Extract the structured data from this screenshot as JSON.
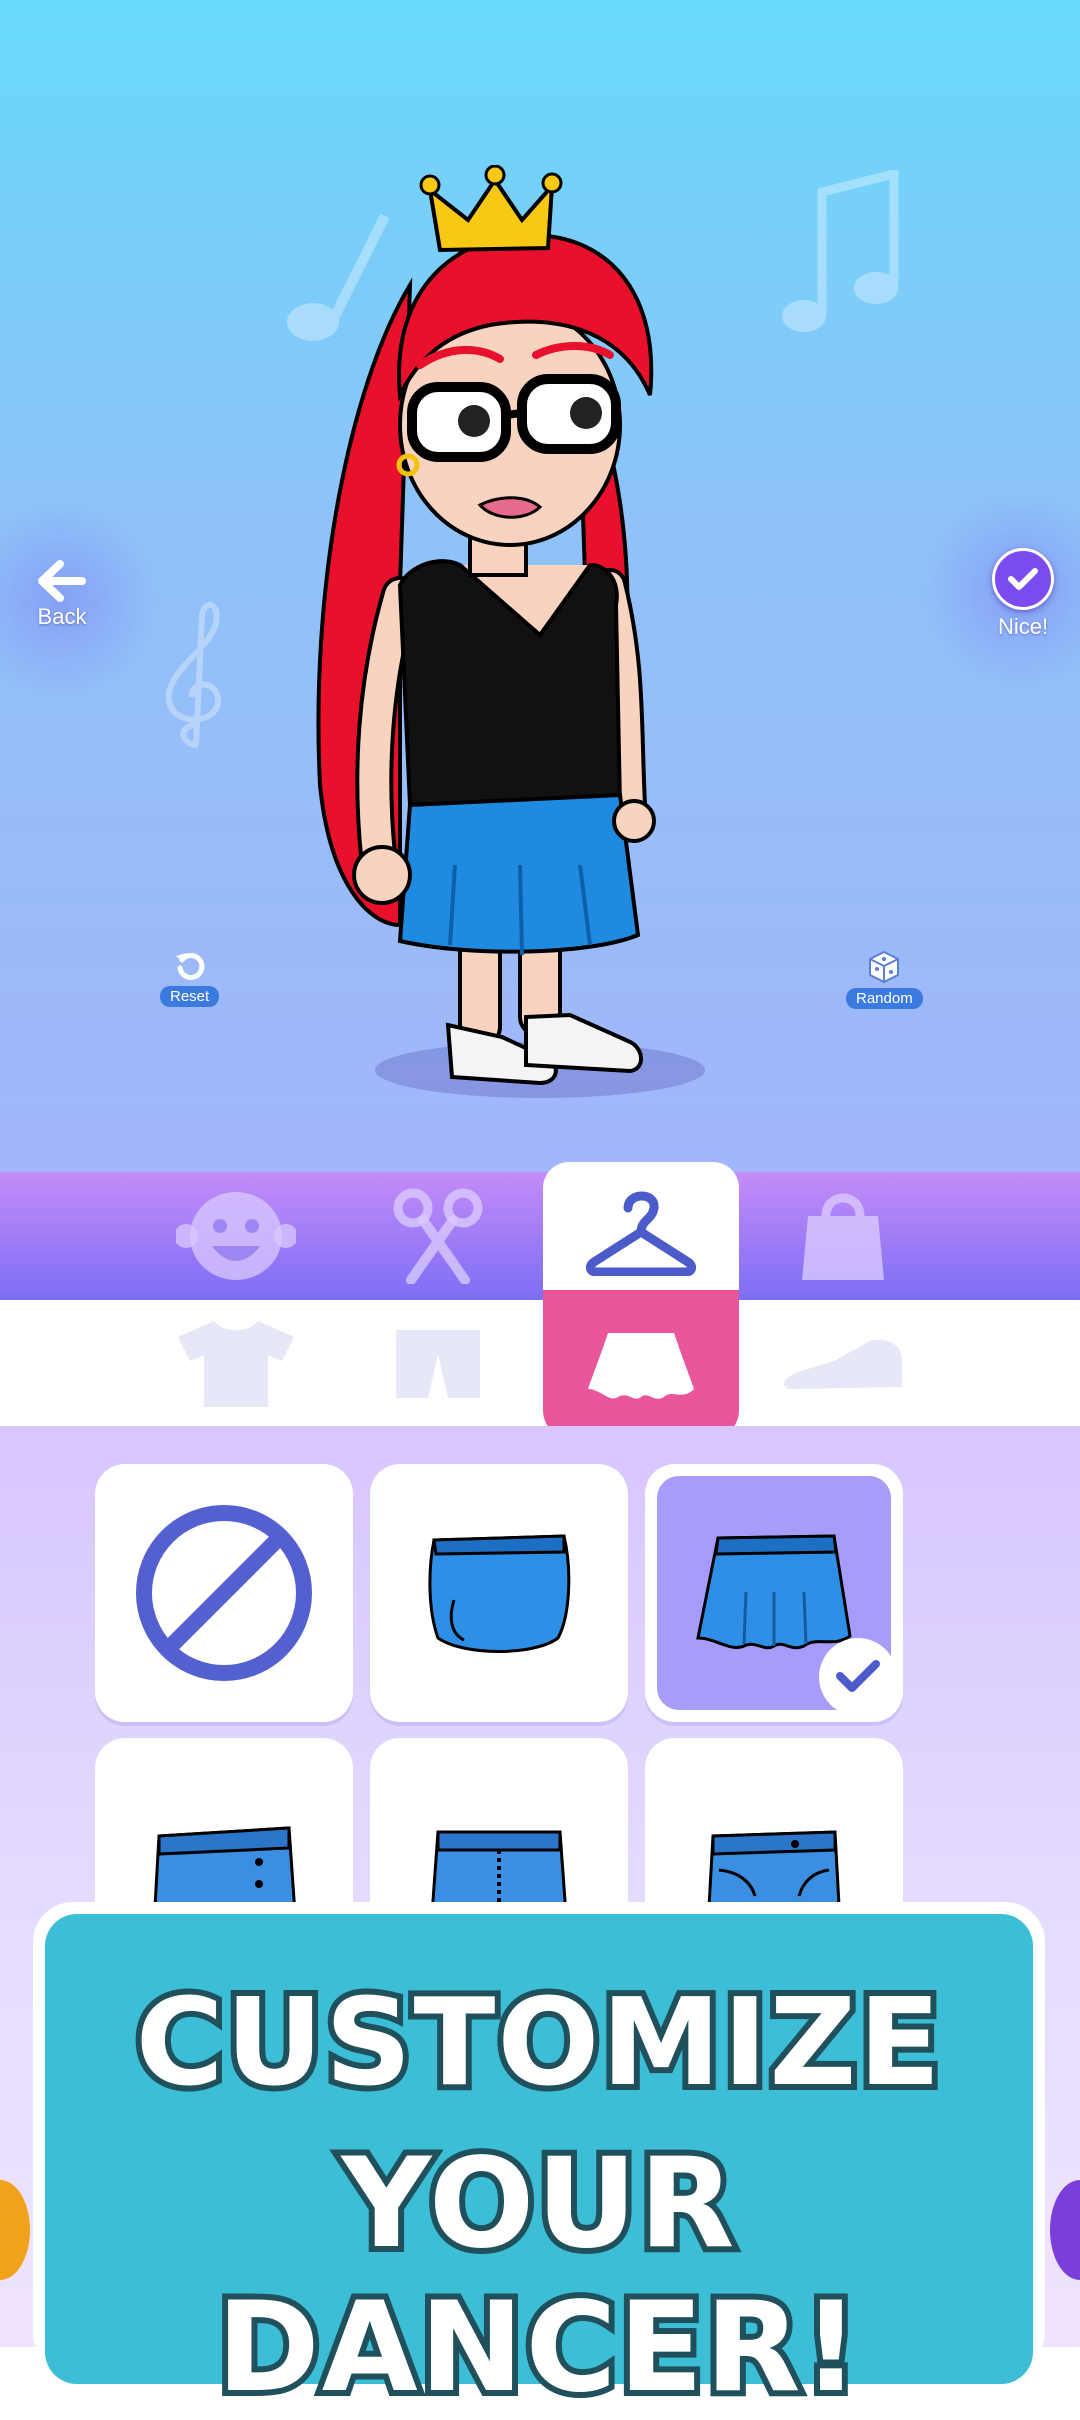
{
  "stage": {
    "back_label": "Back",
    "nice_label": "Nice!",
    "reset_label": "Reset",
    "random_label": "Random"
  },
  "category_tabs": [
    {
      "name": "face",
      "icon": "face-icon",
      "active": false
    },
    {
      "name": "hair",
      "icon": "scissors-icon",
      "active": false
    },
    {
      "name": "clothes",
      "icon": "hanger-icon",
      "active": true
    },
    {
      "name": "accessories",
      "icon": "bag-icon",
      "active": false
    }
  ],
  "sub_tabs": [
    {
      "name": "tops",
      "icon": "shirt-icon",
      "active": false
    },
    {
      "name": "shorts",
      "icon": "shorts-icon",
      "active": false
    },
    {
      "name": "skirts",
      "icon": "skirt-icon",
      "active": true
    },
    {
      "name": "shoes",
      "icon": "shoe-icon",
      "active": false
    }
  ],
  "items": [
    {
      "name": "none",
      "icon": "none-icon",
      "selected": false
    },
    {
      "name": "blue-mini-skirt",
      "icon": "skirt-icon",
      "selected": false
    },
    {
      "name": "blue-pleated-skirt",
      "icon": "skirt-icon",
      "selected": true
    },
    {
      "name": "denim-skirt-buttons",
      "icon": "denim-skirt-icon",
      "selected": false
    },
    {
      "name": "denim-skirt-zip",
      "icon": "denim-skirt-icon",
      "selected": false
    },
    {
      "name": "denim-skirt-pockets",
      "icon": "denim-skirt-icon",
      "selected": false
    }
  ],
  "banner": {
    "line1": "CUSTOMIZE",
    "line2": "YOUR DANCER!"
  },
  "colors": {
    "accent_purple": "#7d6ef5",
    "accent_pink": "#e9559a",
    "banner_teal": "#3cbfd6",
    "item_selected": "#a79cfb",
    "icon_blue": "#5460d0"
  }
}
